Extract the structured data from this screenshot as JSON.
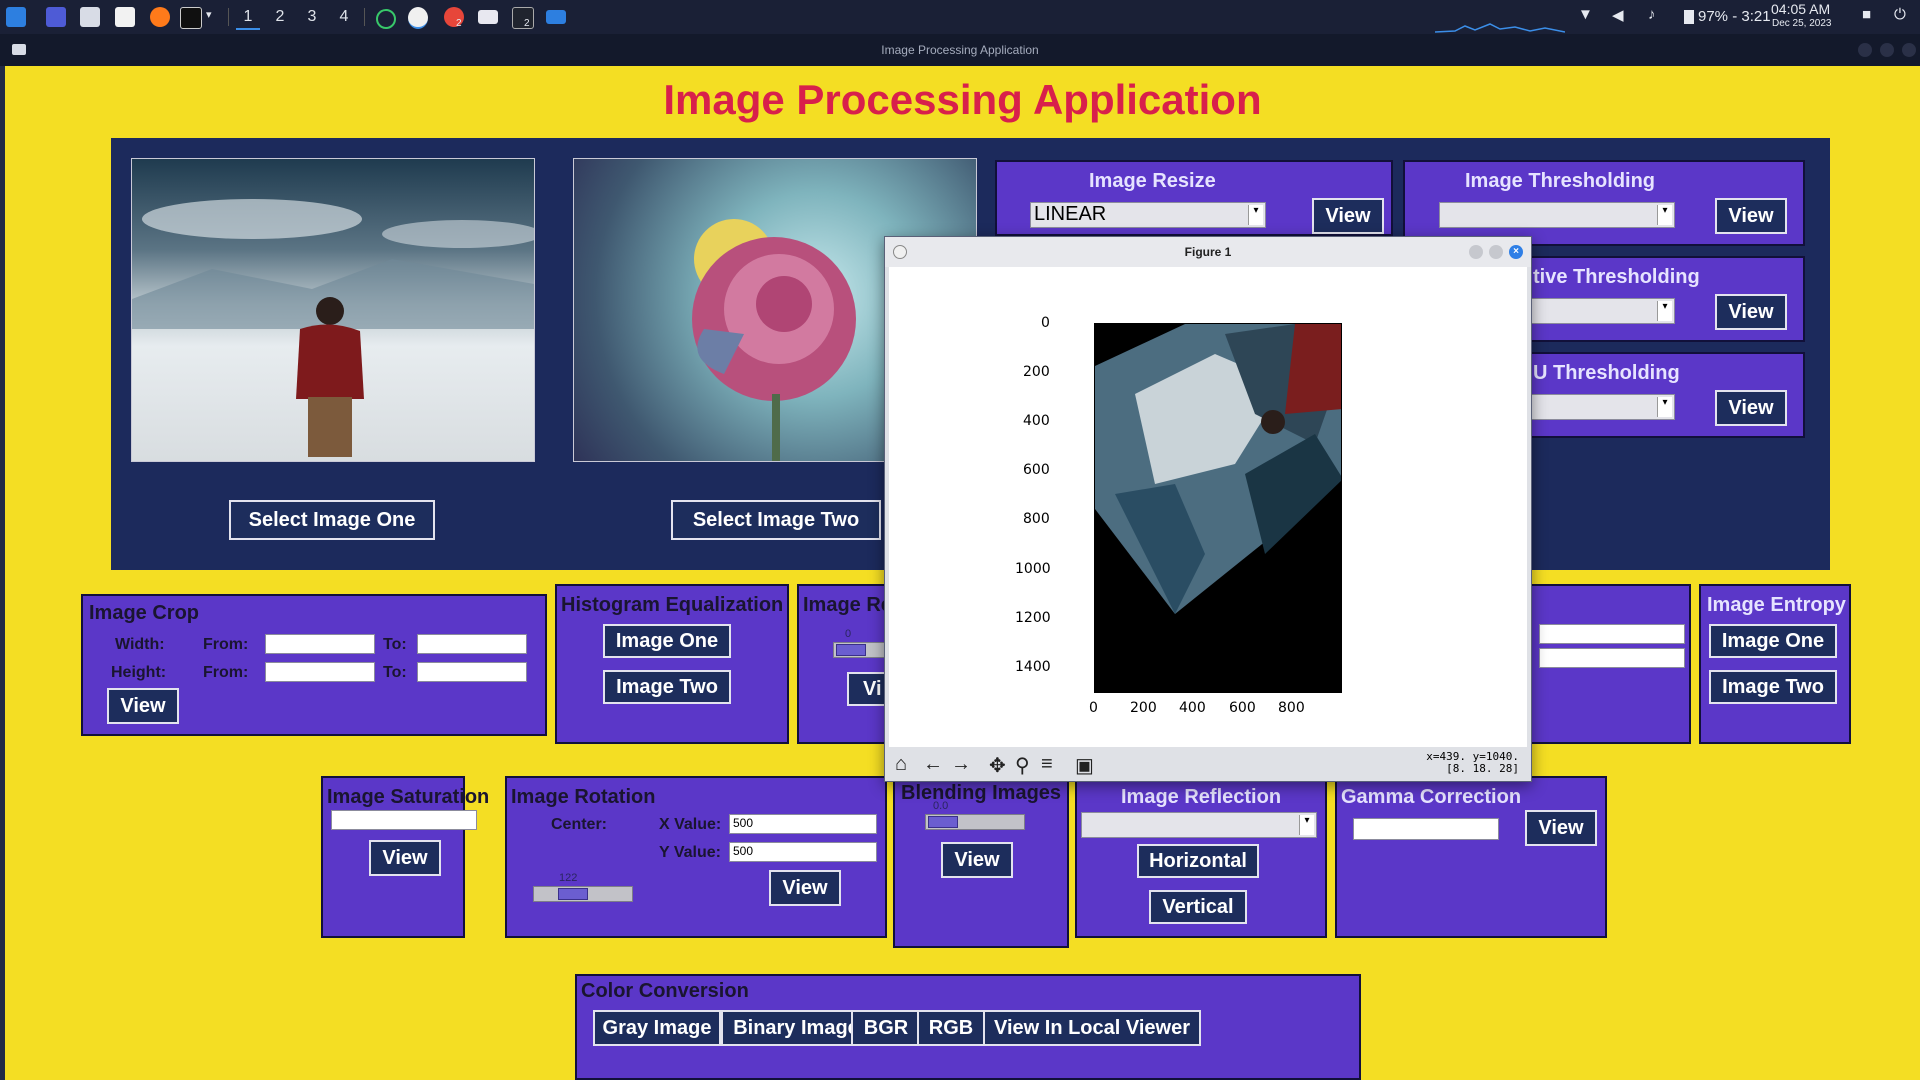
{
  "taskbar": {
    "workspaces": [
      "1",
      "2",
      "3",
      "4"
    ],
    "badge_chrome": "2",
    "badge_term": "2",
    "battery": "97% - 3:21",
    "time": "04:05 AM",
    "date": "Dec 25, 2023"
  },
  "window": {
    "title": "Image Processing Application"
  },
  "app": {
    "title": "Image Processing Application",
    "select_one": "Select Image One",
    "select_two": "Select Image Two"
  },
  "resize": {
    "title": "Image Resize",
    "value": "LINEAR",
    "view": "View"
  },
  "threshold": {
    "title": "Image Thresholding",
    "view": "View"
  },
  "adaptive": {
    "title": "tive Thresholding",
    "view": "View"
  },
  "otsu": {
    "title": "U Thresholding",
    "view": "View"
  },
  "crop": {
    "title": "Image Crop",
    "width": "Width:",
    "height": "Height:",
    "from": "From:",
    "to": "To:",
    "view": "View"
  },
  "histogram": {
    "title": "Histogram Equalization",
    "one": "Image One",
    "two": "Image Two"
  },
  "image_re": {
    "title": "Image Re",
    "scale_value": "0",
    "view": "Vi"
  },
  "entropy": {
    "title": "Image Entropy",
    "one": "Image One",
    "two": "Image Two"
  },
  "saturation": {
    "title": "Image Saturation",
    "view": "View"
  },
  "rotation": {
    "title": "Image Rotation",
    "center": "Center:",
    "x_label": "X Value:",
    "y_label": "Y Value:",
    "x_value": "500",
    "y_value": "500",
    "scale_value": "122",
    "view": "View"
  },
  "blending": {
    "title": "Blending Images",
    "scale_value": "0.0",
    "view": "View"
  },
  "reflection": {
    "title": "Image Reflection",
    "horizontal": "Horizontal",
    "vertical": "Vertical"
  },
  "gamma": {
    "title": "Gamma Correction",
    "view": "View"
  },
  "color": {
    "title": "Color Conversion",
    "gray": "Gray Image",
    "binary": "Binary Image",
    "bgr": "BGR",
    "rgb": "RGB",
    "local": "View In Local Viewer"
  },
  "figure": {
    "title": "Figure 1",
    "status_line1": "x=439. y=1040.",
    "status_line2": "[8. 18. 28]",
    "y_ticks": [
      "0",
      "200",
      "400",
      "600",
      "800",
      "1000",
      "1200",
      "1400"
    ],
    "x_ticks": [
      "0",
      "200",
      "400",
      "600",
      "800"
    ]
  },
  "colors": {
    "app_bg": "#f4de23",
    "panel": "#5b37c8",
    "top_panel": "#1c2a5c",
    "title": "#d8204b"
  }
}
